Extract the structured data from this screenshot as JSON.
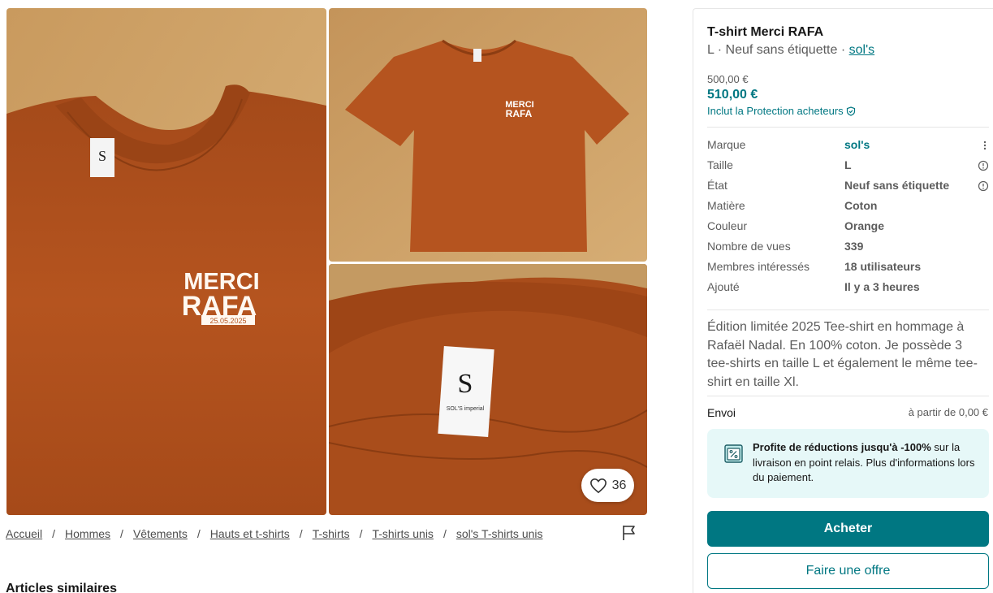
{
  "gallery": {
    "print_text_line1": "MERCI",
    "print_text_line2": "RAFA",
    "print_date": "25.05.2025",
    "favourite_count": "36"
  },
  "breadcrumb": [
    "Accueil",
    "Hommes",
    "Vêtements",
    "Hauts et t-shirts",
    "T-shirts",
    "T-shirts unis",
    "sol's T-shirts unis"
  ],
  "breadcrumb_separator": "/",
  "similar_heading": "Articles similaires",
  "item": {
    "title": "T-shirt Merci RAFA",
    "subtitle_prefix": "L · Neuf sans étiquette · ",
    "subtitle_brand": "sol's",
    "price_original": "500,00 €",
    "price_total": "510,00 €",
    "protection_text": "Inclut la Protection acheteurs"
  },
  "details": [
    {
      "key": "Marque",
      "value": "sol's",
      "link": true,
      "icon": "more-vertical-icon"
    },
    {
      "key": "Taille",
      "value": "L",
      "link": false,
      "icon": "info-icon"
    },
    {
      "key": "État",
      "value": "Neuf sans étiquette",
      "link": false,
      "icon": "info-icon"
    },
    {
      "key": "Matière",
      "value": "Coton",
      "link": false,
      "icon": ""
    },
    {
      "key": "Couleur",
      "value": "Orange",
      "link": false,
      "icon": ""
    },
    {
      "key": "Nombre de vues",
      "value": "339",
      "link": false,
      "icon": ""
    },
    {
      "key": "Membres intéressés",
      "value": "18 utilisateurs",
      "link": false,
      "icon": ""
    },
    {
      "key": "Ajouté",
      "value": "Il y a 3 heures",
      "link": false,
      "icon": ""
    }
  ],
  "description": "Édition limitée 2025 Tee-shirt en hommage à Rafaël Nadal. En 100% coton. Je possède 3 tee-shirts en taille L et également le même tee-shirt en taille Xl.",
  "shipping": {
    "label": "Envoi",
    "value": "à partir de 0,00 €"
  },
  "promo": {
    "bold_text": "Profite de réductions jusqu'à -100%",
    "rest_text": " sur la livraison en point relais. Plus d'informations lors du paiement."
  },
  "actions": {
    "buy_label": "Acheter",
    "offer_label": "Faire une offre"
  },
  "colors": {
    "accent": "#007782",
    "promo_bg": "#e6f8f8",
    "shirt": "#b5541f"
  }
}
